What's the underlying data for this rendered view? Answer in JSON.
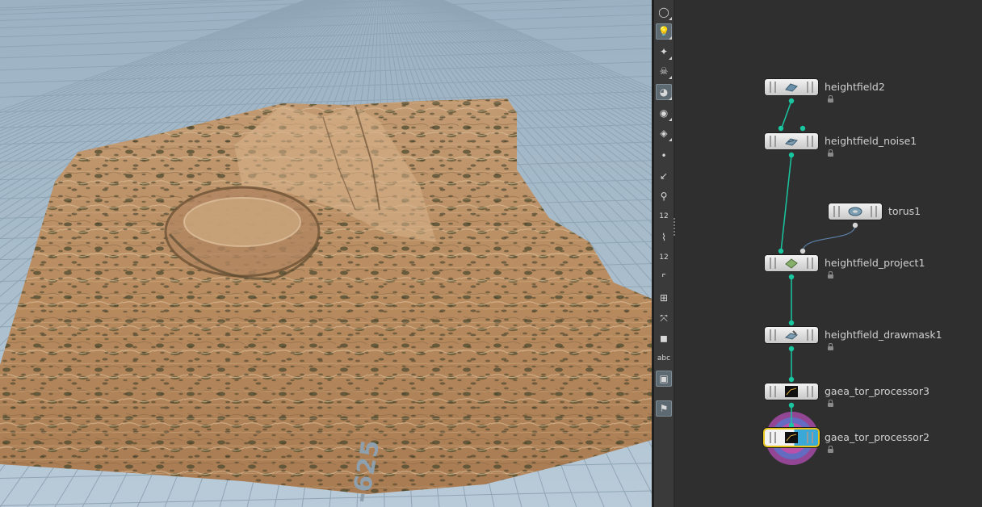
{
  "viewport": {
    "axis_label": "-625",
    "background_color": "#a9bdcc",
    "terrain_color": "#b98d63"
  },
  "toolbar": {
    "tools": [
      {
        "icon": "sphere-icon",
        "active": false
      },
      {
        "icon": "light-bulb-icon",
        "active": true
      },
      {
        "icon": "point-light-icon",
        "active": false
      },
      {
        "icon": "skull-icon",
        "active": false
      },
      {
        "icon": "ball-icon",
        "active": true
      },
      {
        "icon": "eye-icon",
        "active": false
      },
      {
        "icon": "eye-toggle-icon",
        "active": false
      },
      {
        "icon": "dot-icon",
        "active": false
      },
      {
        "icon": "arrow-icon",
        "active": false
      },
      {
        "icon": "dropper-icon",
        "active": false
      },
      {
        "icon": "point-number-icon",
        "active": false,
        "text": "12"
      },
      {
        "icon": "paint-icon",
        "active": false
      },
      {
        "icon": "primitive-number-icon",
        "active": false,
        "text": "12"
      },
      {
        "icon": "corner-icon",
        "active": false
      },
      {
        "icon": "snap-grid-icon",
        "active": false
      },
      {
        "icon": "axis-icon",
        "active": false
      },
      {
        "icon": "stop-icon",
        "active": false
      },
      {
        "icon": "text-icon",
        "active": false,
        "text": "abc"
      },
      {
        "icon": "image-icon",
        "active": true
      },
      {
        "icon": "pin-icon",
        "active": true
      }
    ]
  },
  "network": {
    "wire_color": "#18c6a0",
    "nodes": [
      {
        "name": "heightfield2"
      },
      {
        "name": "heightfield_noise1"
      },
      {
        "name": "torus1"
      },
      {
        "name": "heightfield_project1"
      },
      {
        "name": "heightfield_drawmask1"
      },
      {
        "name": "gaea_tor_processor3"
      },
      {
        "name": "gaea_tor_processor2"
      }
    ]
  }
}
